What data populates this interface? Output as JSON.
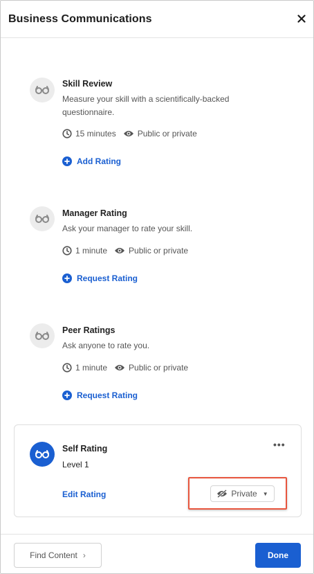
{
  "header": {
    "title": "Business Communications",
    "close_icon": "close-icon"
  },
  "ratings": [
    {
      "title": "Skill Review",
      "description": "Measure your skill with a scientifically-backed questionnaire.",
      "duration": "15 minutes",
      "visibility": "Public or private",
      "action": "Add Rating",
      "icon": "glasses-icon"
    },
    {
      "title": "Manager Rating",
      "description": "Ask your manager to rate your skill.",
      "duration": "1 minute",
      "visibility": "Public or private",
      "action": "Request Rating",
      "icon": "glasses-icon"
    },
    {
      "title": "Peer Ratings",
      "description": "Ask anyone to rate you.",
      "duration": "1 minute",
      "visibility": "Public or private",
      "action": "Request Rating",
      "icon": "glasses-icon"
    }
  ],
  "self_rating": {
    "title": "Self Rating",
    "level": "Level 1",
    "edit_label": "Edit Rating",
    "more_label": "•••",
    "privacy_label": "Private",
    "privacy_caret": "▼"
  },
  "footer": {
    "find_label": "Find Content",
    "find_chevron": "›",
    "done_label": "Done"
  },
  "colors": {
    "accent": "#1a5fd1",
    "highlight": "#e8553d",
    "icon_bg": "#ececec"
  }
}
